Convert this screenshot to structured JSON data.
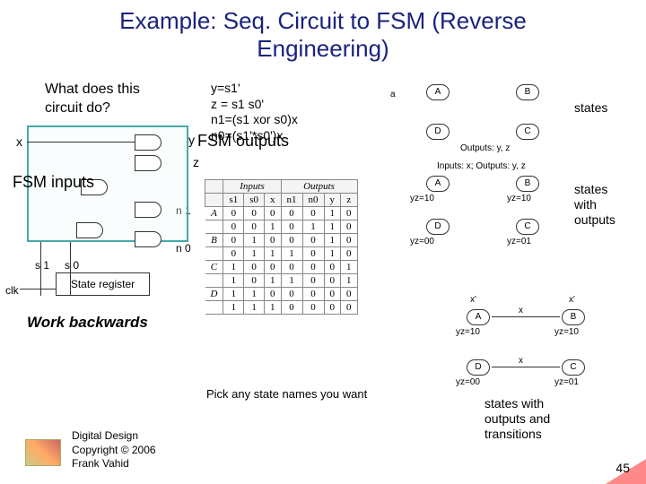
{
  "title_line1": "Example: Seq. Circuit to FSM (Reverse",
  "title_line2": "Engineering)",
  "question_l1": "What does this",
  "question_l2": "circuit do?",
  "eq_y": "y=s1'",
  "eq_z": "z = s1 s0'",
  "eq_n1": "n1=(s1 xor s0)x",
  "eq_n0": "n0=(s1'*s0')x",
  "fsm_outputs": "FSM outputs",
  "fsm_inputs": "FSM inputs",
  "sig": {
    "x": "x",
    "y": "y",
    "z": "z",
    "n1": "n 1",
    "n0": "n 0",
    "s1": "s 1",
    "s0": "s 0",
    "clk": "clk"
  },
  "state_register": "State register",
  "work_backwards": "Work backwards",
  "pick_names": "Pick any state names you want",
  "right_labels": {
    "states": "states",
    "states_outputs": "states\nwith\noutputs",
    "states_full": "states with\noutputs and\ntransitions"
  },
  "footer": {
    "l1": "Digital Design",
    "l2": "Copyright © 2006",
    "l3": "Frank Vahid"
  },
  "page": "45",
  "state_diagram": {
    "sd1_header": "Outputs: y, z",
    "sd2_header": "Inputs: x; Outputs: y, z",
    "nodes": [
      "A",
      "B",
      "C",
      "D"
    ],
    "sd2_annot": {
      "A": "yz=10",
      "B": "yz=10",
      "C": "yz=01",
      "D": "yz=00"
    },
    "sd3_edges": {
      "loop": "x'",
      "trans": "x",
      "labels": [
        "yz=10",
        "yz=10",
        "yz=01",
        "yz=00"
      ]
    }
  },
  "truth_table": {
    "group_headers": [
      "Inputs",
      "Outputs"
    ],
    "cols": [
      "s1",
      "s0",
      "x",
      "n1",
      "n0",
      "y",
      "z"
    ],
    "row_labels": [
      "A",
      "B",
      "C",
      "D"
    ],
    "rows": [
      [
        0,
        0,
        0,
        0,
        0,
        1,
        0
      ],
      [
        0,
        0,
        1,
        0,
        1,
        1,
        0
      ],
      [
        0,
        1,
        0,
        0,
        0,
        1,
        0
      ],
      [
        0,
        1,
        1,
        1,
        0,
        1,
        0
      ],
      [
        1,
        0,
        0,
        0,
        0,
        0,
        1
      ],
      [
        1,
        0,
        1,
        1,
        0,
        0,
        1
      ],
      [
        1,
        1,
        0,
        0,
        0,
        0,
        0
      ],
      [
        1,
        1,
        1,
        0,
        0,
        0,
        0
      ]
    ]
  },
  "a_marker": "a"
}
